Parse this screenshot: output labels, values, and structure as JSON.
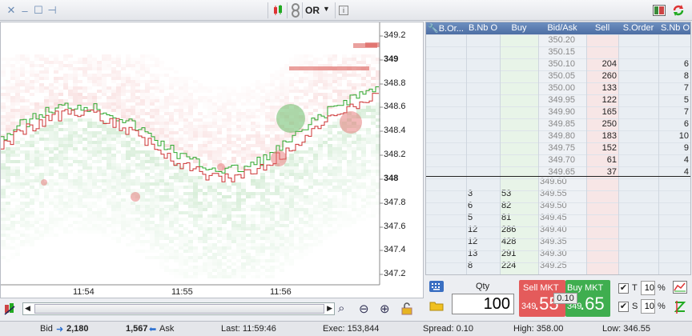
{
  "toolbar": {
    "symbol": "OR",
    "info_icon": "i"
  },
  "chart": {
    "y_labels": [
      "349.2",
      "349",
      "348.8",
      "348.6",
      "348.4",
      "348.2",
      "348",
      "347.8",
      "347.6",
      "347.4",
      "347.2"
    ],
    "x_labels": [
      "11:54",
      "11:55",
      "11:56"
    ]
  },
  "book": {
    "headers": [
      "B.Or...",
      "B.Nb O",
      "Buy",
      "Bid/Ask",
      "Sell",
      "S.Order",
      "S.Nb O"
    ],
    "asks": [
      {
        "price": "350.20",
        "sell": "",
        "snb": ""
      },
      {
        "price": "350.15",
        "sell": "",
        "snb": ""
      },
      {
        "price": "350.10",
        "sell": "204",
        "snb": "6"
      },
      {
        "price": "350.05",
        "sell": "260",
        "snb": "8"
      },
      {
        "price": "350.00",
        "sell": "133",
        "snb": "7"
      },
      {
        "price": "349.95",
        "sell": "122",
        "snb": "5"
      },
      {
        "price": "349.90",
        "sell": "165",
        "snb": "7"
      },
      {
        "price": "349.85",
        "sell": "250",
        "snb": "6"
      },
      {
        "price": "349.80",
        "sell": "183",
        "snb": "10"
      },
      {
        "price": "349.75",
        "sell": "152",
        "snb": "9"
      },
      {
        "price": "349.70",
        "sell": "61",
        "snb": "4"
      },
      {
        "price": "349.65",
        "sell": "37",
        "snb": "4"
      }
    ],
    "bids": [
      {
        "price": "349.60",
        "bnb": "",
        "buy": ""
      },
      {
        "price": "349.55",
        "bnb": "3",
        "buy": "53"
      },
      {
        "price": "349.50",
        "bnb": "6",
        "buy": "82"
      },
      {
        "price": "349.45",
        "bnb": "5",
        "buy": "81"
      },
      {
        "price": "349.40",
        "bnb": "12",
        "buy": "286"
      },
      {
        "price": "349.35",
        "bnb": "12",
        "buy": "428"
      },
      {
        "price": "349.30",
        "bnb": "13",
        "buy": "291"
      },
      {
        "price": "349.25",
        "bnb": "8",
        "buy": "224"
      }
    ]
  },
  "panel": {
    "qty_label": "Qty",
    "qty_value": "100",
    "sell_label": "Sell MKT",
    "buy_label": "Buy MKT",
    "sell_small": "349",
    "sell_big": ".55",
    "buy_small": "349",
    "buy_big": ".65",
    "spread": "0.10",
    "t_label": "T",
    "t_value": "10",
    "s_label": "S",
    "s_value": "10",
    "pct": "%"
  },
  "status": {
    "bid_label": "Bid",
    "bid_value": "2,180",
    "ask_value": "1,567",
    "ask_label": "Ask",
    "last": "Last: 11:59:46",
    "exec": "Exec: 153,844",
    "spread": "Spread: 0.10",
    "high": "High: 358.00",
    "low": "Low: 346.55"
  },
  "colors": {
    "ask_bg": "#f8e1e1",
    "bid_bg": "#e2f3e2",
    "sell_btn": "#e45b5b",
    "buy_btn": "#3fae4f"
  }
}
